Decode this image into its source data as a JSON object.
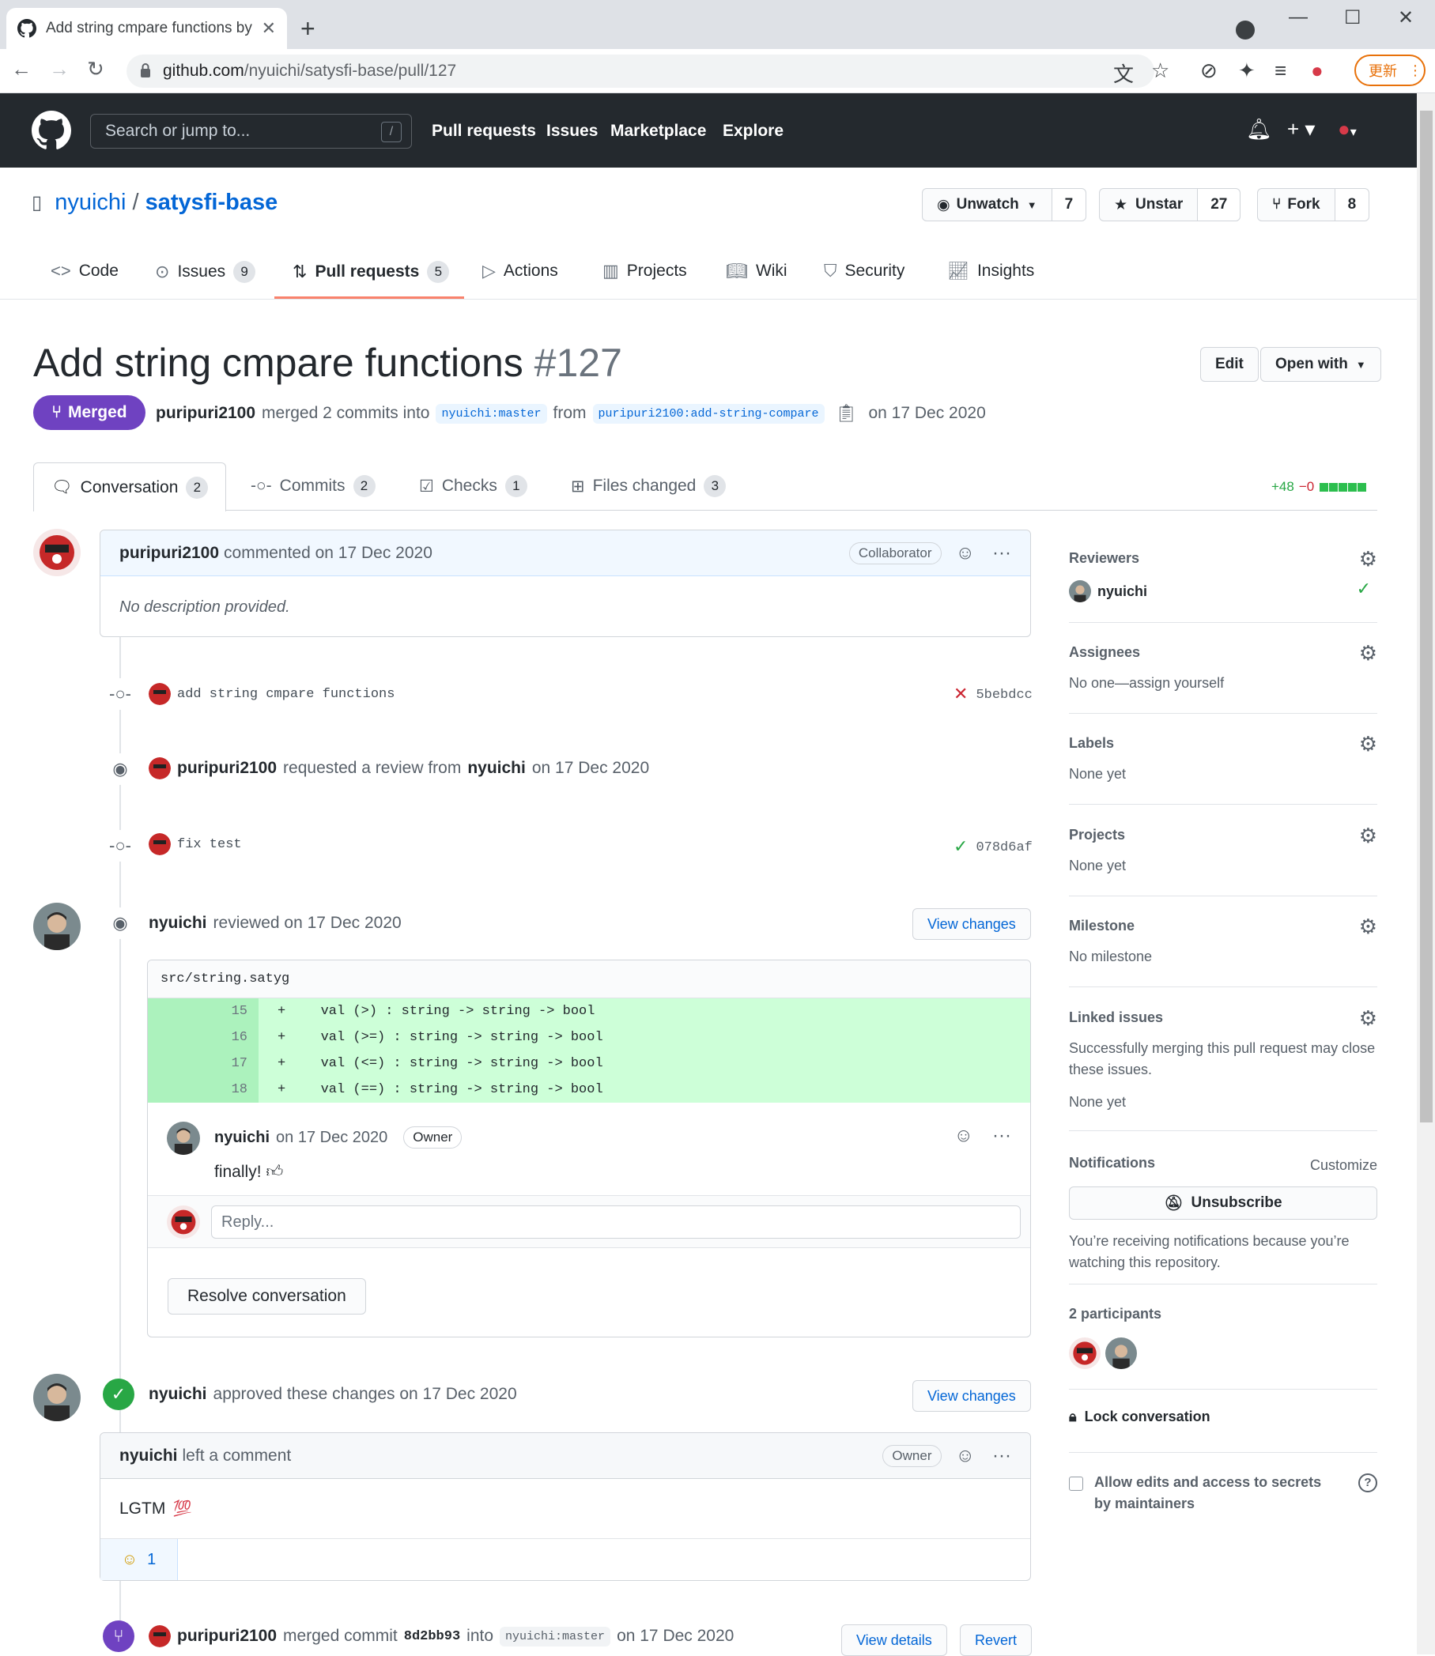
{
  "browser": {
    "tab_title": "Add string cmpare functions by p",
    "url_host": "github.com",
    "url_path": "/nyuichi/satysfi-base/pull/127",
    "update_label": "更新",
    "accent": "#e8710a"
  },
  "header": {
    "search_placeholder": "Search or jump to...",
    "search_shortcut": "/",
    "nav": [
      "Pull requests",
      "Issues",
      "Marketplace",
      "Explore"
    ]
  },
  "repo": {
    "owner": "nyuichi",
    "name": "satysfi-base",
    "watch_label": "Unwatch",
    "watch_count": "7",
    "star_label": "Unstar",
    "star_count": "27",
    "fork_label": "Fork",
    "fork_count": "8",
    "tabs": [
      {
        "label": "Code",
        "count": ""
      },
      {
        "label": "Issues",
        "count": "9"
      },
      {
        "label": "Pull requests",
        "count": "5"
      },
      {
        "label": "Actions",
        "count": ""
      },
      {
        "label": "Projects",
        "count": ""
      },
      {
        "label": "Wiki",
        "count": ""
      },
      {
        "label": "Security",
        "count": ""
      },
      {
        "label": "Insights",
        "count": ""
      }
    ]
  },
  "pr": {
    "title": "Add string cmpare functions",
    "number": "#127",
    "edit_label": "Edit",
    "open_with_label": "Open with",
    "state": "Merged",
    "author": "puripuri2100",
    "merged_text": "merged 2 commits into",
    "base_branch": "nyuichi:master",
    "from_text": "from",
    "head_branch": "puripuri2100:add-string-compare",
    "date_text": "on 17 Dec 2020",
    "merged_color": "#6f42c1",
    "tabs": [
      {
        "label": "Conversation",
        "count": "2"
      },
      {
        "label": "Commits",
        "count": "2"
      },
      {
        "label": "Checks",
        "count": "1"
      },
      {
        "label": "Files changed",
        "count": "3"
      }
    ],
    "additions": "+48",
    "deletions": "−0"
  },
  "timeline": {
    "first_comment": {
      "author": "puripuri2100",
      "meta": "commented on 17 Dec 2020",
      "role": "Collaborator",
      "body": "No description provided."
    },
    "commit1": {
      "message": "add string cmpare functions",
      "sha": "5bebdcc",
      "status": "failed"
    },
    "review_request": {
      "actor": "puripuri2100",
      "text": "requested a review from",
      "reviewer": "nyuichi",
      "date": "on 17 Dec 2020"
    },
    "commit2": {
      "message": "fix test",
      "sha": "078d6af",
      "status": "success"
    },
    "review": {
      "author": "nyuichi",
      "meta": "reviewed on 17 Dec 2020",
      "view_changes": "View changes",
      "file": "src/string.satyg",
      "lines": [
        {
          "num": "15",
          "sign": "+",
          "code": "  val (>) : string -> string -> bool"
        },
        {
          "num": "16",
          "sign": "+",
          "code": "  val (>=) : string -> string -> bool"
        },
        {
          "num": "17",
          "sign": "+",
          "code": "  val (<=) : string -> string -> bool"
        },
        {
          "num": "18",
          "sign": "+",
          "code": "  val (==) : string -> string -> bool"
        }
      ],
      "comment_author": "nyuichi",
      "comment_meta": "on 17 Dec 2020",
      "comment_role": "Owner",
      "comment_body": "finally!",
      "reply_placeholder": "Reply...",
      "resolve_label": "Resolve conversation"
    },
    "approval": {
      "author": "nyuichi",
      "meta": "approved these changes on 17 Dec 2020",
      "view_changes": "View changes",
      "comment_author": "nyuichi",
      "comment_meta": "left a comment",
      "comment_role": "Owner",
      "comment_body": "LGTM",
      "reaction_count": "1"
    },
    "merge": {
      "actor": "puripuri2100",
      "text": "merged commit",
      "sha": "8d2bb93",
      "into": "into",
      "branch": "nyuichi:master",
      "date": "on 17 Dec 2020",
      "view_details": "View details",
      "revert": "Revert"
    }
  },
  "sidebar": {
    "reviewers_title": "Reviewers",
    "reviewer": "nyuichi",
    "assignees_title": "Assignees",
    "assignees_value": "No one—assign yourself",
    "labels_title": "Labels",
    "labels_value": "None yet",
    "projects_title": "Projects",
    "projects_value": "None yet",
    "milestone_title": "Milestone",
    "milestone_value": "No milestone",
    "linked_title": "Linked issues",
    "linked_desc": "Successfully merging this pull request may close these issues.",
    "linked_value": "None yet",
    "notifications_title": "Notifications",
    "customize": "Customize",
    "unsubscribe": "Unsubscribe",
    "notifications_desc": "You’re receiving notifications because you’re watching this repository.",
    "participants_title": "2 participants",
    "lock": "Lock conversation",
    "allow_edits": "Allow edits and access to secrets by maintainers"
  }
}
